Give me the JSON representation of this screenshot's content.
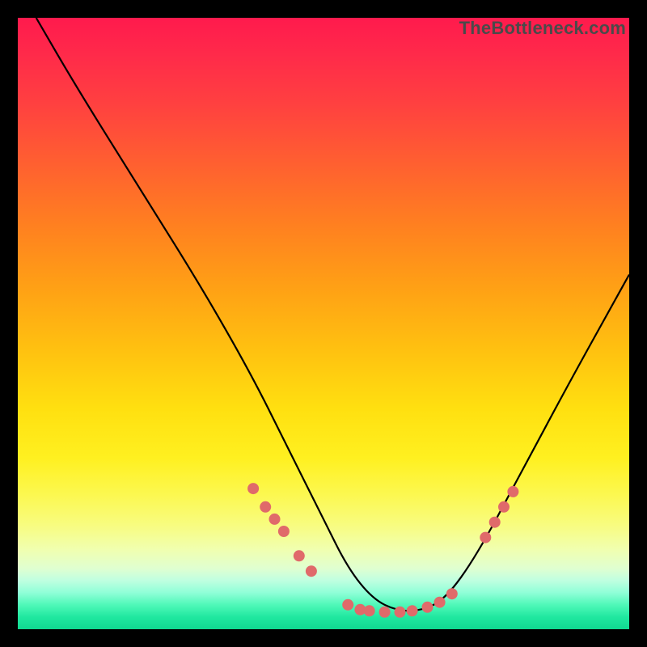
{
  "watermark": "TheBottleneck.com",
  "chart_data": {
    "type": "line",
    "title": "",
    "xlabel": "",
    "ylabel": "",
    "xlim": [
      0,
      100
    ],
    "ylim": [
      0,
      100
    ],
    "grid": false,
    "legend": false,
    "background": "red-yellow-green vertical gradient (bottleneck heatmap)",
    "series": [
      {
        "name": "bottleneck-curve",
        "x": [
          3,
          10,
          20,
          30,
          38,
          44,
          50,
          54,
          58,
          62,
          66,
          70,
          75,
          82,
          90,
          100
        ],
        "y": [
          100,
          88,
          72,
          56,
          42,
          30,
          18,
          10,
          5,
          3,
          3,
          5,
          12,
          25,
          40,
          58
        ]
      }
    ],
    "markers": [
      {
        "name": "highlight-dots-left",
        "x": [
          38.5,
          40.5,
          42.0,
          43.5,
          46.0,
          48.0
        ],
        "y": [
          23.0,
          20.0,
          18.0,
          16.0,
          12.0,
          9.5
        ]
      },
      {
        "name": "highlight-dots-bottom",
        "x": [
          54.0,
          56.0,
          57.5,
          60.0,
          62.5,
          64.5,
          67.0,
          69.0,
          71.0
        ],
        "y": [
          4.0,
          3.2,
          3.0,
          2.8,
          2.8,
          3.0,
          3.6,
          4.4,
          5.8
        ]
      },
      {
        "name": "highlight-dots-right",
        "x": [
          76.5,
          78.0,
          79.5,
          81.0
        ],
        "y": [
          15.0,
          17.5,
          20.0,
          22.5
        ]
      }
    ]
  }
}
